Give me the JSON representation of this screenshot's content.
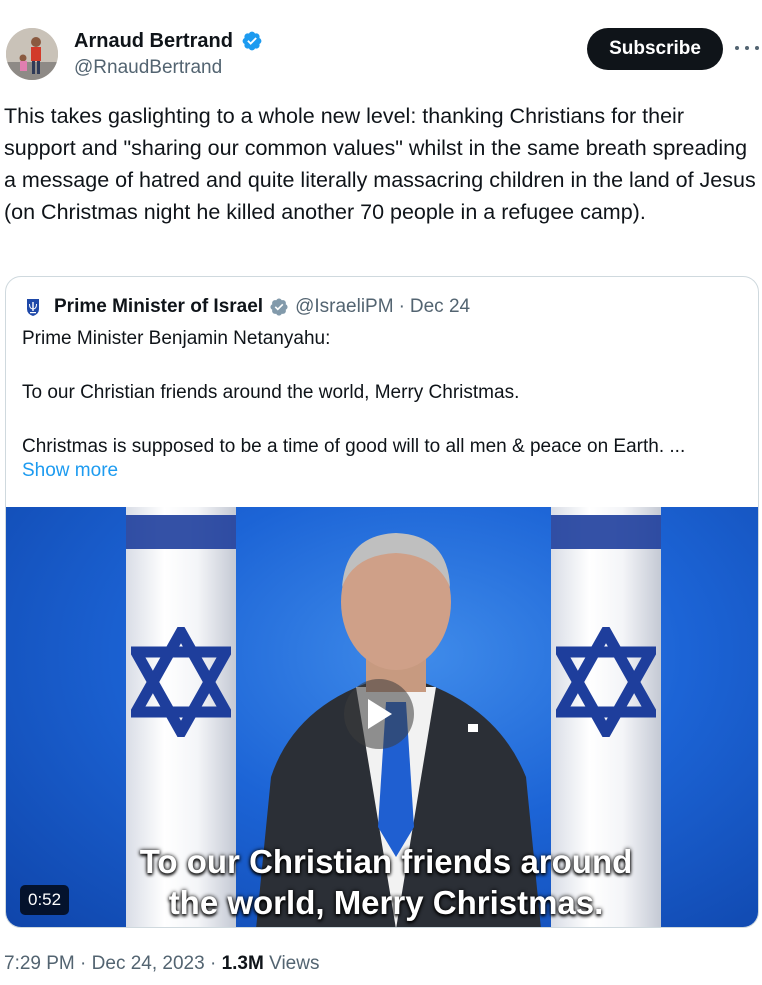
{
  "author": {
    "name": "Arnaud Bertrand",
    "handle": "@RnaudBertrand",
    "verified": true
  },
  "actions": {
    "subscribe_label": "Subscribe"
  },
  "tweet": {
    "text": "This takes gaslighting to a whole new level: thanking Christians for their support and \"sharing our common values\" whilst in the same breath spreading a message of hatred and quite literally massacring children in the land of Jesus (on Christmas night he killed another 70 people in a refugee camp)."
  },
  "quote": {
    "name": "Prime Minister of Israel",
    "handle": "@IsraeliPM",
    "separator": "·",
    "date": "Dec 24",
    "lines": [
      "Prime Minister Benjamin Netanyahu:",
      "To our Christian friends around the world, Merry Christmas.",
      "Christmas is supposed to be a time of good will to all men & peace on Earth. ..."
    ],
    "show_more": "Show more",
    "video": {
      "subtitle_line1": "To our Christian friends around",
      "subtitle_line2": "the world, Merry Christmas.",
      "duration": "0:52"
    }
  },
  "meta": {
    "time": "7:29 PM",
    "separator": "·",
    "date": "Dec 24, 2023",
    "views_count": "1.3M",
    "views_label": "Views"
  },
  "colors": {
    "accent": "#1d9bf0",
    "text": "#0f1419",
    "secondary": "#536471"
  }
}
